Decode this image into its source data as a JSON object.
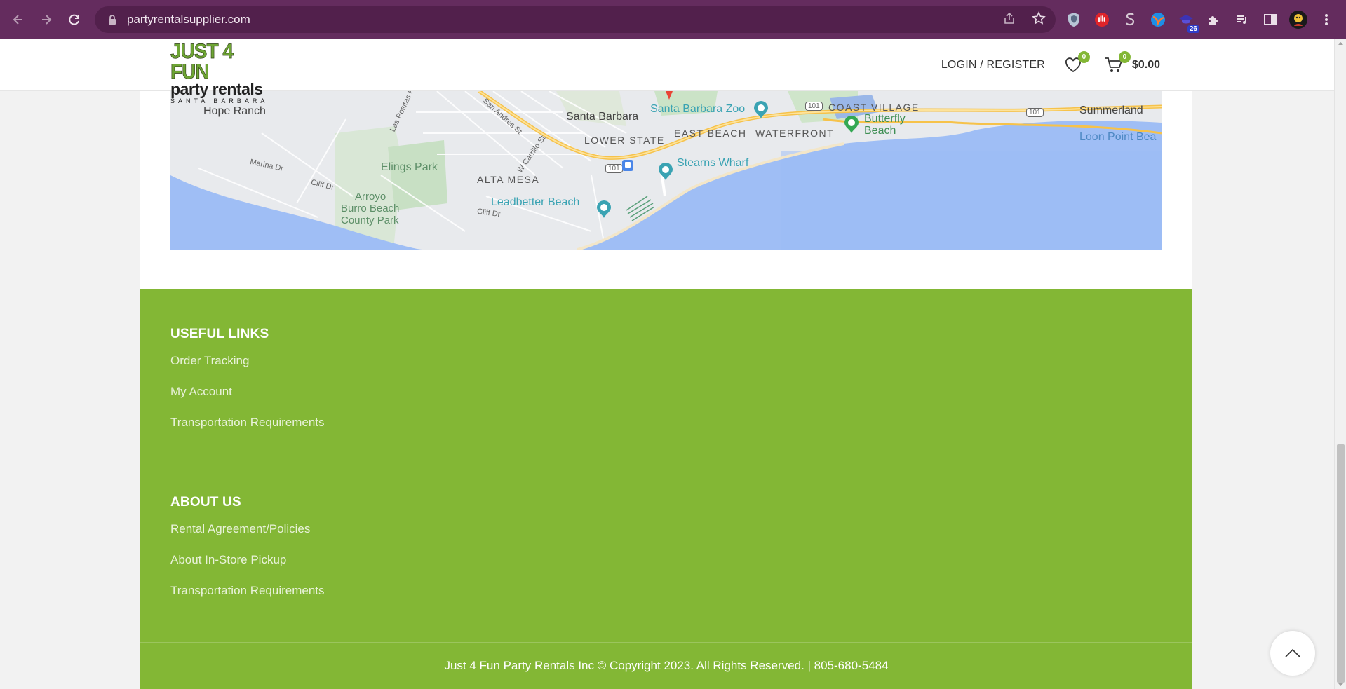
{
  "browser": {
    "url": "partyrentalsupplier.com",
    "extension_badge": "26"
  },
  "header": {
    "logo": {
      "line1": "JUST 4 FUN",
      "line2": "party rentals",
      "line3": "SANTA BARBARA"
    },
    "login_label": "LOGIN / REGISTER",
    "wishlist_count": "0",
    "cart_count": "0",
    "cart_total": "$0.00"
  },
  "map": {
    "labels": {
      "hope_ranch": "Hope Ranch",
      "santa_barbara": "Santa Barbara",
      "zoo": "Santa Barbara Zoo",
      "coast_village": "COAST VILLAGE",
      "summerland": "Summerland",
      "lower_state": "LOWER STATE",
      "east_beach": "EAST BEACH",
      "waterfront": "WATERFRONT",
      "butterfly_beach_1": "Butterfly",
      "butterfly_beach_2": "Beach",
      "loon_point": "Loon Point Bea",
      "elings_park": "Elings Park",
      "alta_mesa": "ALTA MESA",
      "stearns_wharf": "Stearns Wharf",
      "leadbetter_beach": "Leadbetter Beach",
      "arroyo_1": "Arroyo",
      "arroyo_2": "Burro Beach",
      "arroyo_3": "County Park",
      "marina_dr": "Marina Dr",
      "cliff_dr": "Cliff Dr",
      "cliff_dr_2": "Cliff Dr",
      "las_positas": "Las Positas Rd",
      "san_andres": "San Andres St",
      "w_carrillo": "W Carrillo St",
      "hwy_101_a": "101",
      "hwy_101_b": "101",
      "hwy_101_c": "101"
    }
  },
  "footer": {
    "useful_links": {
      "title": "USEFUL LINKS",
      "items": [
        "Order Tracking",
        "My Account",
        "Transportation Requirements"
      ]
    },
    "about_us": {
      "title": "ABOUT US",
      "items": [
        "Rental Agreement/Policies",
        "About In-Store Pickup",
        "Transportation Requirements"
      ]
    },
    "copyright": "Just 4 Fun Party Rentals Inc © Copyright 2023. All Rights Reserved. | 805-680-5484"
  },
  "colors": {
    "browser_frame": "#642c5e",
    "footer_green": "#83b735",
    "badge_green": "#83b735"
  }
}
